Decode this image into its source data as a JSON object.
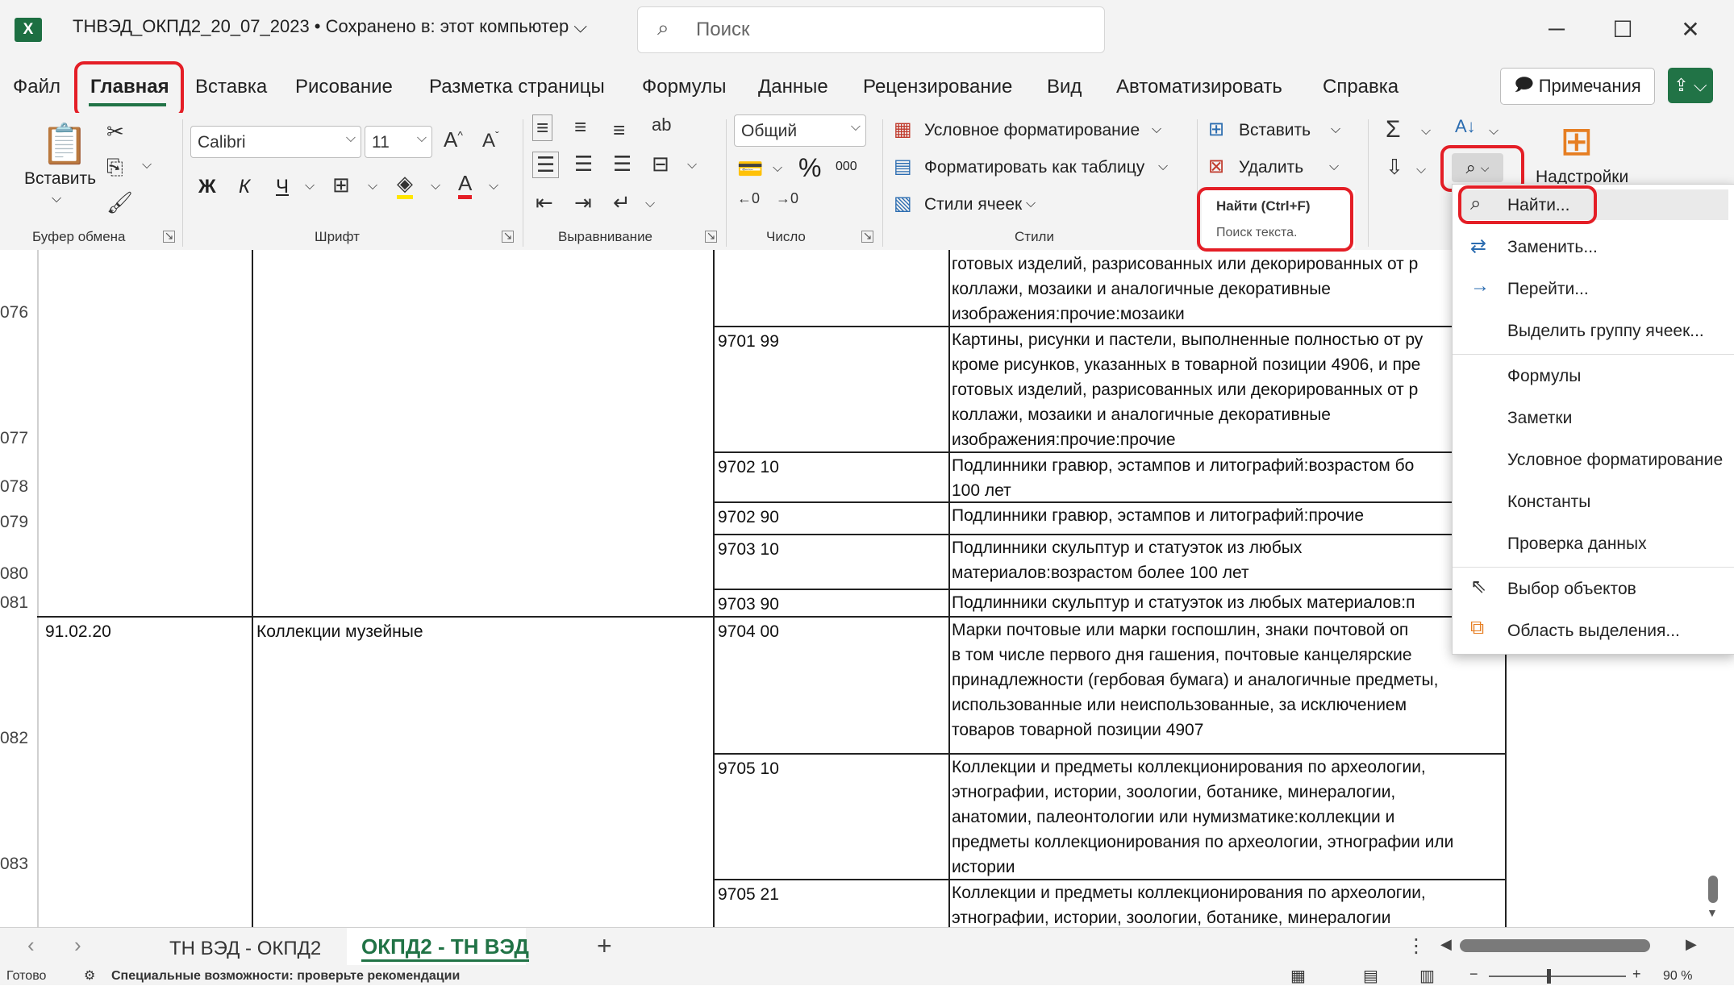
{
  "app": {
    "logo": "X",
    "title": "ТНВЭД_ОКПД2_20_07_2023 • Сохранено в: этот компьютер",
    "search_placeholder": "Поиск"
  },
  "menu": {
    "tabs": [
      "Файл",
      "Главная",
      "Вставка",
      "Рисование",
      "Разметка страницы",
      "Формулы",
      "Данные",
      "Рецензирование",
      "Вид",
      "Автоматизировать",
      "Справка"
    ],
    "active": "Главная",
    "notes": "Примечания"
  },
  "ribbon": {
    "clipboard": {
      "paste": "Вставить",
      "label": "Буфер обмена"
    },
    "font": {
      "name": "Calibri",
      "size": "11",
      "bold": "Ж",
      "italic": "К",
      "underline": "Ч",
      "label": "Шрифт"
    },
    "alignment": {
      "label": "Выравнивание"
    },
    "number": {
      "format": "Общий",
      "percent": "%",
      "thousands": "000",
      "label": "Число"
    },
    "styles": {
      "conditional": "Условное форматирование",
      "as_table": "Форматировать как таблицу",
      "cell_styles": "Стили ячеек",
      "label": "Стили"
    },
    "cells": {
      "insert": "Вставить",
      "delete": "Удалить"
    },
    "addins": "Надстройки",
    "tooltip": {
      "title": "Найти (Ctrl+F)",
      "desc": "Поиск текста."
    }
  },
  "find_menu": {
    "items": [
      "Найти...",
      "Заменить...",
      "Перейти...",
      "Выделить группу ячеек...",
      "Формулы",
      "Заметки",
      "Условное форматирование",
      "Константы",
      "Проверка данных",
      "Выбор объектов",
      "Область выделения..."
    ]
  },
  "sheet": {
    "row_numbers": [
      "076",
      "077",
      "078",
      "079",
      "080",
      "081",
      "082",
      "083"
    ],
    "okpd_code": "91.02.20",
    "okpd_name": "Коллекции музейные",
    "rows": [
      {
        "code": "",
        "lines": [
          "готовых изделий, разрисованных или декорированных от р",
          "коллажи, мозаики и аналогичные декоративные",
          "изображения:прочие:мозаики"
        ]
      },
      {
        "code": "9701 99",
        "lines": [
          "Картины, рисунки и пастели, выполненные полностью от ру",
          "кроме рисунков, указанных в товарной позиции 4906, и пре",
          "готовых изделий, разрисованных или декорированных от р",
          "коллажи, мозаики и аналогичные декоративные",
          "изображения:прочие:прочие"
        ]
      },
      {
        "code": "9702 10",
        "lines": [
          "Подлинники гравюр, эстампов и литографий:возрастом бо",
          "100 лет"
        ]
      },
      {
        "code": "9702 90",
        "lines": [
          "Подлинники гравюр, эстампов и литографий:прочие"
        ]
      },
      {
        "code": "9703 10",
        "lines": [
          "Подлинники скульптур и статуэток из любых",
          "материалов:возрастом более 100 лет"
        ]
      },
      {
        "code": "9703 90",
        "lines": [
          "Подлинники скульптур и статуэток из любых материалов:п"
        ]
      },
      {
        "code": "9704 00",
        "lines": [
          "Марки почтовые или марки госпошлин, знаки почтовой оп",
          "в том числе первого дня гашения, почтовые канцелярские",
          "принадлежности (гербовая бумага) и аналогичные предметы,",
          "использованные или неиспользованные, за исключением",
          "товаров товарной позиции 4907"
        ]
      },
      {
        "code": "9705 10",
        "lines": [
          "Коллекции и предметы коллекционирования по археологии,",
          "этнографии, истории, зоологии, ботанике, минералогии,",
          "анатомии, палеонтологии или нумизматике:коллекции и",
          "предметы коллекционирования по археологии, этнографии или",
          "истории"
        ]
      },
      {
        "code": "9705 21",
        "lines": [
          "Коллекции и предметы коллекционирования по археологии,",
          "этнографии, истории, зоологии, ботанике, минералогии"
        ]
      }
    ]
  },
  "sheet_tabs": {
    "tabs": [
      "ТН ВЭД - ОКПД2",
      "ОКПД2 - ТН ВЭД"
    ],
    "active": "ОКПД2 - ТН ВЭД",
    "add": "+"
  },
  "status": {
    "ready": "Готово",
    "accessibility": "Специальные возможности: проверьте рекомендации",
    "zoom": "90 %"
  },
  "colors": {
    "accent": "#217346",
    "highlight": "#e41e26"
  }
}
